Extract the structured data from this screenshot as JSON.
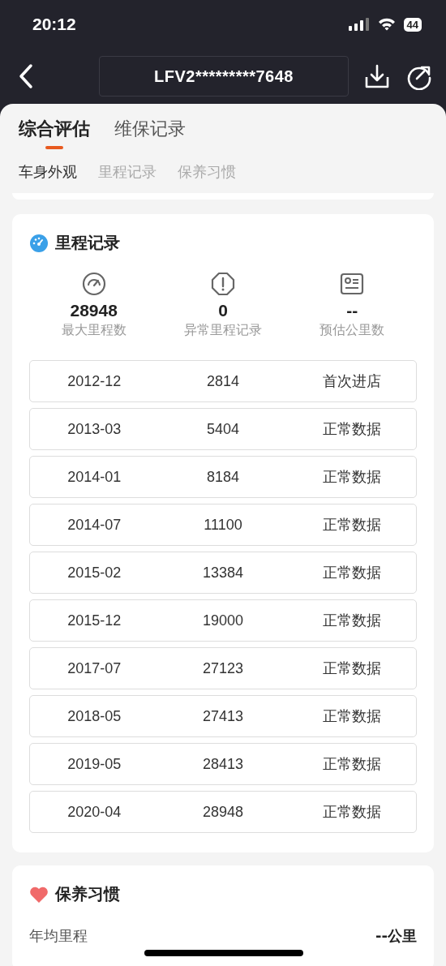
{
  "status_bar": {
    "time": "20:12",
    "battery": "44"
  },
  "nav": {
    "title": "LFV2*********7648"
  },
  "tabs": [
    {
      "label": "综合评估",
      "selected": true
    },
    {
      "label": "维保记录",
      "selected": false
    }
  ],
  "sub_tabs": [
    {
      "label": "车身外观",
      "selected": true
    },
    {
      "label": "里程记录",
      "selected": false
    },
    {
      "label": "保养习惯",
      "selected": false
    }
  ],
  "mileage": {
    "title": "里程记录",
    "stats": [
      {
        "kind": "gauge",
        "value": "28948",
        "label": "最大里程数"
      },
      {
        "kind": "alert",
        "value": "0",
        "label": "异常里程记录"
      },
      {
        "kind": "card",
        "value": "--",
        "label": "预估公里数"
      }
    ],
    "rows": [
      {
        "date": "2012-12",
        "km": "2814",
        "status": "首次进店"
      },
      {
        "date": "2013-03",
        "km": "5404",
        "status": "正常数据"
      },
      {
        "date": "2014-01",
        "km": "8184",
        "status": "正常数据"
      },
      {
        "date": "2014-07",
        "km": "11100",
        "status": "正常数据"
      },
      {
        "date": "2015-02",
        "km": "13384",
        "status": "正常数据"
      },
      {
        "date": "2015-12",
        "km": "19000",
        "status": "正常数据"
      },
      {
        "date": "2017-07",
        "km": "27123",
        "status": "正常数据"
      },
      {
        "date": "2018-05",
        "km": "27413",
        "status": "正常数据"
      },
      {
        "date": "2019-05",
        "km": "28413",
        "status": "正常数据"
      },
      {
        "date": "2020-04",
        "km": "28948",
        "status": "正常数据"
      }
    ]
  },
  "maintenance": {
    "title": "保养习惯",
    "label": "年均里程",
    "value": "--公里"
  }
}
